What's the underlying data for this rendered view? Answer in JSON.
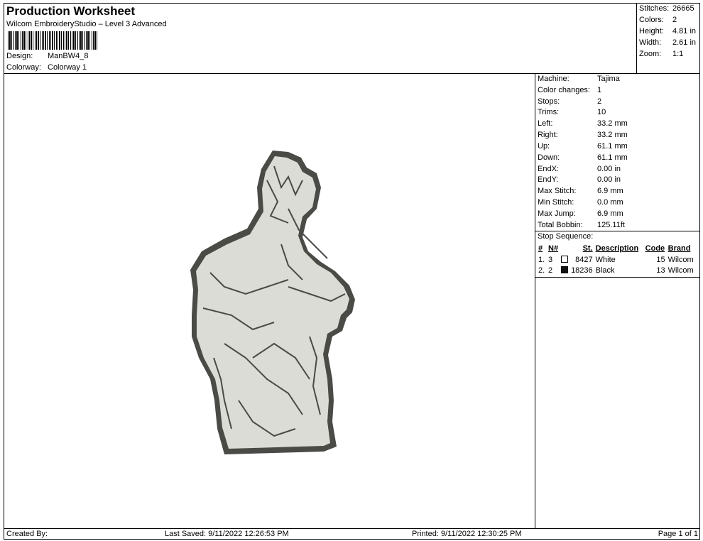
{
  "header": {
    "title": "Production Worksheet",
    "subtitle": "Wilcom EmbroideryStudio – Level 3 Advanced",
    "design_label": "Design:",
    "design_value": "ManBW4_8",
    "colorway_label": "Colorway:",
    "colorway_value": "Colorway 1"
  },
  "stats": [
    {
      "label": "Stitches:",
      "value": "26665"
    },
    {
      "label": "Colors:",
      "value": "2"
    },
    {
      "label": "Height:",
      "value": "4.81 in"
    },
    {
      "label": "Width:",
      "value": "2.61 in"
    },
    {
      "label": "Zoom:",
      "value": "1:1"
    }
  ],
  "machine_info": [
    {
      "label": "Machine:",
      "value": "Tajima"
    },
    {
      "label": "Color changes:",
      "value": "1"
    },
    {
      "label": "Stops:",
      "value": "2"
    },
    {
      "label": "Trims:",
      "value": "10"
    },
    {
      "label": "Left:",
      "value": "33.2 mm"
    },
    {
      "label": "Right:",
      "value": "33.2 mm"
    },
    {
      "label": "Up:",
      "value": "61.1 mm"
    },
    {
      "label": "Down:",
      "value": "61.1 mm"
    },
    {
      "label": "EndX:",
      "value": "0.00 in"
    },
    {
      "label": "EndY:",
      "value": "0.00 in"
    },
    {
      "label": "Max Stitch:",
      "value": "6.9 mm"
    },
    {
      "label": "Min Stitch:",
      "value": "0.0 mm"
    },
    {
      "label": "Max Jump:",
      "value": "6.9 mm"
    },
    {
      "label": "Total Bobbin:",
      "value": "125.11ft"
    }
  ],
  "stop_sequence": {
    "title": "Stop Sequence:",
    "columns": [
      "#",
      "N#",
      "St.",
      "Description",
      "Code",
      "Brand"
    ],
    "rows": [
      {
        "index": "1.",
        "n": "3",
        "color": "#ffffff",
        "stitches": "8427",
        "description": "White",
        "code": "15",
        "brand": "Wilcom"
      },
      {
        "index": "2.",
        "n": "2",
        "color": "#111111",
        "stitches": "18236",
        "description": "Black",
        "code": "13",
        "brand": "Wilcom"
      }
    ]
  },
  "footer": {
    "created_by": "Created By:",
    "last_saved": "Last Saved: 9/11/2022 12:26:53 PM",
    "printed": "Printed: 9/11/2022 12:30:25 PM",
    "page": "Page 1 of 1"
  },
  "colors": {
    "thread_fill": "#dcdcd6",
    "thread_outline": "#4a4a46"
  }
}
